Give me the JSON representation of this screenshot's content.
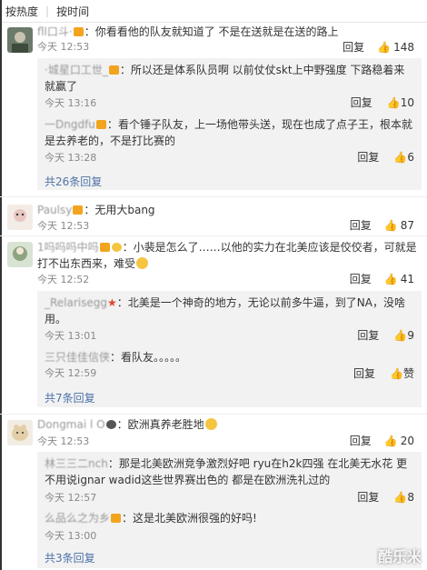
{
  "sort": {
    "hot": "按热度",
    "time": "按时间"
  },
  "comments": [
    {
      "name": "fll口斗·",
      "text": "你看看他的队友就知道了 不是在送就是在送的路上",
      "time": "今天 12:53",
      "reply": "回复",
      "likes": "148",
      "replies": [
        {
          "name": "·城星口工世_",
          "text": "所以还是体系队员啊 以前仗仗skt上中野强度 下路稳着来就赢了",
          "time": "今天 13:16",
          "reply": "回复",
          "likes": "10"
        },
        {
          "name": "一Dngdfu",
          "text": "看个锤子队友，上一场他带头送，现在也成了点子王，根本就是去养老的，不是打比赛的",
          "time": "今天 13:28",
          "reply": "回复",
          "likes": "6"
        }
      ],
      "more": "共26条回复"
    },
    {
      "name": "Paulsy",
      "text": "无用大bang",
      "time": "今天 12:53",
      "reply": "回复",
      "likes": "87"
    },
    {
      "name": "1吗吗吗中吗",
      "text": "小裴是怎么了……以他的实力在北美应该是佼佼者，可就是打不出东西来，难受",
      "time": "今天 12:52",
      "reply": "回复",
      "likes": "41",
      "replies": [
        {
          "name": "_Relarisegg",
          "text": "北美是一个神奇的地方，无论以前多牛逼，到了NA，没啥用。",
          "time": "今天 13:01",
          "reply": "回复",
          "likes": "9"
        },
        {
          "name": "三只佳佳信侠",
          "text": "看队友。。。。。",
          "time": "今天 12:59",
          "reply": "回复",
          "likes": "赞"
        }
      ],
      "more": "共7条回复"
    },
    {
      "name": "Dongmai l O",
      "text": "欧洲真养老胜地",
      "time": "今天 12:53",
      "reply": "回复",
      "likes": "20",
      "replies": [
        {
          "name": "林三三二nch",
          "text": "那是北美欧洲竞争激烈好吧 ryu在h2k四强 在北美无水花 更不用说ignar wadid这些世界赛出色的 都是在欧洲洗礼过的",
          "time": "今天 12:57",
          "reply": "回复",
          "likes": "8"
        },
        {
          "name": "么品么之为乡",
          "text": "这是北美欧洲很强的好吗!",
          "time": "今天 13:00",
          "reply": "回复",
          "likes": ""
        }
      ],
      "more": "共3条回复"
    }
  ],
  "watermark": "酷乐米",
  "colors": {
    "link": "#4d72a8",
    "subbg": "#f2f2f2",
    "meta": "#888888"
  }
}
